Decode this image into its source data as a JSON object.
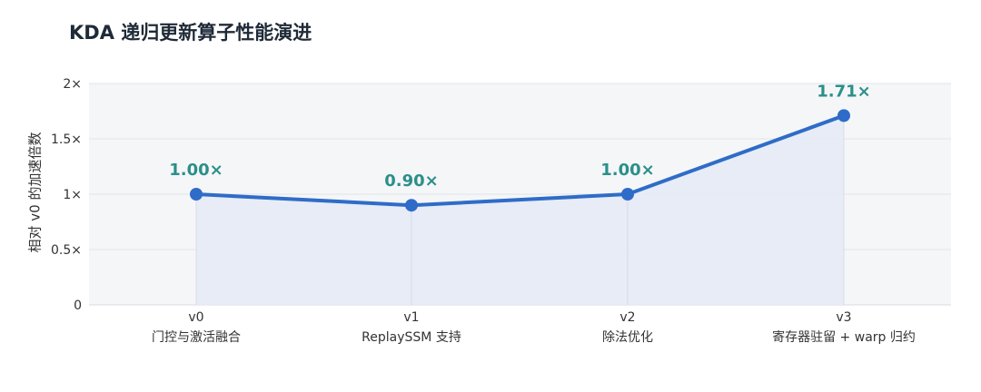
{
  "chart_data": {
    "type": "line",
    "title": "KDA 递归更新算子性能演进",
    "xlabel": "",
    "ylabel": "相对 v0 的加速倍数",
    "ylim": [
      0,
      2
    ],
    "yticks": [
      0,
      0.5,
      1,
      1.5,
      2
    ],
    "ytick_labels": [
      "0",
      "0.5×",
      "1×",
      "1.5×",
      "2×"
    ],
    "categories": [
      {
        "version": "v0",
        "description": "门控与激活融合"
      },
      {
        "version": "v1",
        "description": "ReplaySSM 支持"
      },
      {
        "version": "v2",
        "description": "除法优化"
      },
      {
        "version": "v3",
        "description": "寄存器驻留 + warp 归约"
      }
    ],
    "series": [
      {
        "name": "",
        "values": [
          1.0,
          0.9,
          1.0,
          1.71
        ],
        "data_labels": [
          "1.00×",
          "0.90×",
          "1.00×",
          "1.71×"
        ]
      }
    ],
    "grid": true,
    "area_fill": true,
    "legend": "none"
  },
  "colors": {
    "line": "#2f6cc8",
    "marker": "#2f6cc8",
    "area_fill": "#e5ebf5",
    "plot_background": "#f5f6f8",
    "grid": "#e1e4e9",
    "data_label": "#2b8f8a",
    "title": "#1f2a37"
  }
}
